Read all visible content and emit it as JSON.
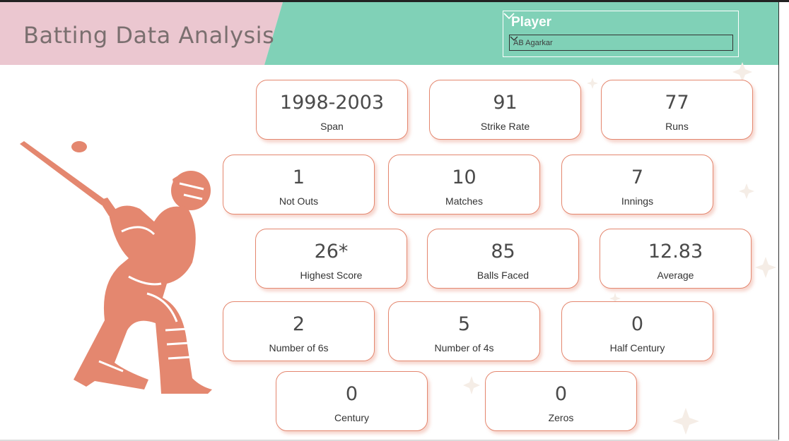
{
  "header": {
    "title": "Batting Data Analysis",
    "colors": {
      "left_panel": "#ebc7d0",
      "right_panel": "#80d1b7"
    }
  },
  "slicer": {
    "title": "Player",
    "selected_value": "AB Agarkar"
  },
  "cards": {
    "span": {
      "value": "1998-2003",
      "label": "Span"
    },
    "strike_rate": {
      "value": "91",
      "label": "Strike Rate"
    },
    "runs": {
      "value": "77",
      "label": "Runs"
    },
    "not_outs": {
      "value": "1",
      "label": "Not Outs"
    },
    "matches": {
      "value": "10",
      "label": "Matches"
    },
    "innings": {
      "value": "7",
      "label": "Innings"
    },
    "highest_score": {
      "value": "26*",
      "label": "Highest Score"
    },
    "balls_faced": {
      "value": "85",
      "label": "Balls Faced"
    },
    "average": {
      "value": "12.83",
      "label": "Average"
    },
    "sixes": {
      "value": "2",
      "label": "Number of 6s"
    },
    "fours": {
      "value": "5",
      "label": "Number of 4s"
    },
    "half_century": {
      "value": "0",
      "label": "Half Century"
    },
    "century": {
      "value": "0",
      "label": "Century"
    },
    "zeros": {
      "value": "0",
      "label": "Zeros"
    }
  },
  "theme": {
    "card_border": "#e4876f",
    "figure": "#e4876f"
  },
  "icons": {
    "slicer_collapse": "chevron-down-icon",
    "dropdown": "chevron-down-icon",
    "figure": "cricket-batsman-icon"
  }
}
